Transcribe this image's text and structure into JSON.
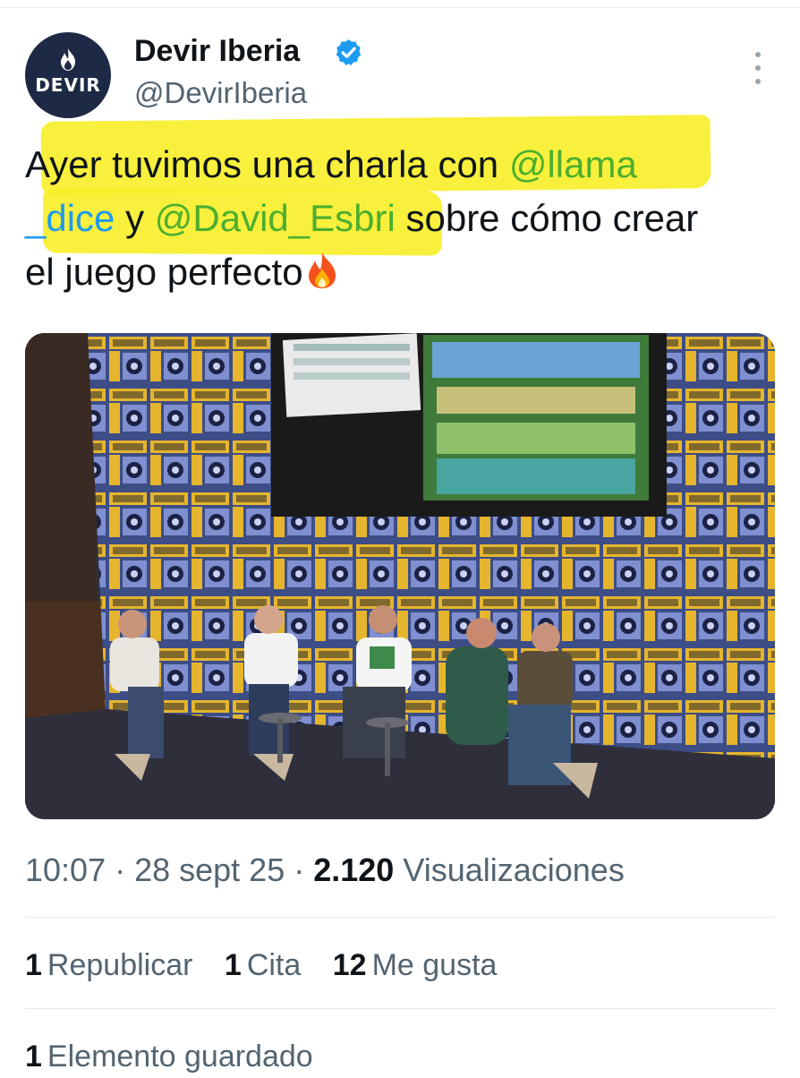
{
  "author": {
    "avatar_text": "DEVIR",
    "name": "Devir Iberia",
    "handle": "@DevirIberia",
    "verified": true
  },
  "tweet": {
    "line1_text": "Ayer tuvimos una charla con ",
    "mention1_part1": "@llama",
    "mention1_part2": "_dice",
    "line2_connector": " y ",
    "mention2": "@David_Esbri",
    "line2_tail": " sobre cómo crear",
    "line3_text": "el juego perfecto"
  },
  "meta": {
    "time": "10:07",
    "sep1": " · ",
    "date": "28 sept 25",
    "sep2": " · ",
    "views_count": "2.120",
    "views_label": " Visualizaciones"
  },
  "stats": {
    "reposts_count": "1",
    "reposts_label": "Republicar",
    "quotes_count": "1",
    "quotes_label": "Cita",
    "likes_count": "12",
    "likes_label": "Me gusta"
  },
  "bookmarks": {
    "count": "1",
    "label": "Elemento guardado"
  },
  "colors": {
    "link": "#1d9bf0",
    "highlight": "#f7ee27",
    "highlighted_link": "#4cae2e",
    "verified": "#1d9bf0",
    "secondary_text": "#536471"
  },
  "icons": {
    "verified": "verified-badge-icon",
    "more": "more-vertical-icon",
    "fire": "fire-emoji-icon"
  }
}
